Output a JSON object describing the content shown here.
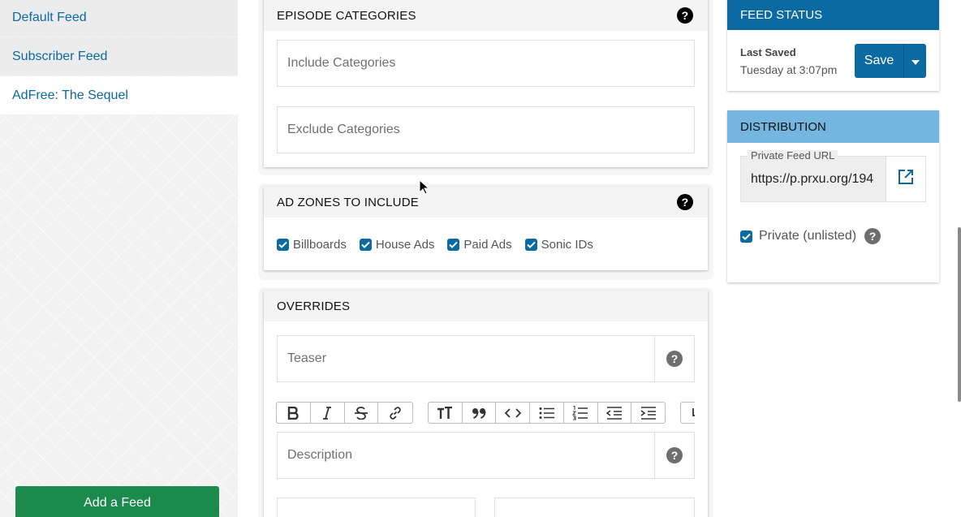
{
  "sidebar": {
    "items": [
      {
        "label": "Default Feed",
        "active": false
      },
      {
        "label": "Subscriber Feed",
        "active": false
      },
      {
        "label": "AdFree: The Sequel",
        "active": true
      }
    ],
    "add_feed_label": "Add a Feed"
  },
  "episode_categories": {
    "title": "EPISODE CATEGORIES",
    "include_placeholder": "Include Categories",
    "exclude_placeholder": "Exclude Categories"
  },
  "ad_zones": {
    "title": "AD ZONES TO INCLUDE",
    "options": [
      {
        "label": "Billboards",
        "checked": true
      },
      {
        "label": "House Ads",
        "checked": true
      },
      {
        "label": "Paid Ads",
        "checked": true
      },
      {
        "label": "Sonic IDs",
        "checked": true
      }
    ]
  },
  "overrides": {
    "title": "OVERRIDES",
    "teaser_placeholder": "Teaser",
    "description_placeholder": "Description",
    "toolbar_icons": [
      "bold-icon",
      "italic-icon",
      "strikethrough-icon",
      "link-icon",
      "heading-icon",
      "quote-icon",
      "code-icon",
      "bullet-list-icon",
      "numbered-list-icon",
      "outdent-icon",
      "indent-icon"
    ]
  },
  "feed_status": {
    "title": "FEED STATUS",
    "last_saved_label": "Last Saved",
    "last_saved_value": "Tuesday at 3:07pm",
    "save_label": "Save"
  },
  "distribution": {
    "title": "DISTRIBUTION",
    "url_label": "Private Feed URL",
    "url_value": "https://p.prxu.org/194",
    "private_label": "Private (unlisted)",
    "private_checked": true
  },
  "help_glyph": "?",
  "colors": {
    "primary": "#0b6aa1",
    "green": "#1d8a4d",
    "distribution_header": "#74b6e0"
  }
}
